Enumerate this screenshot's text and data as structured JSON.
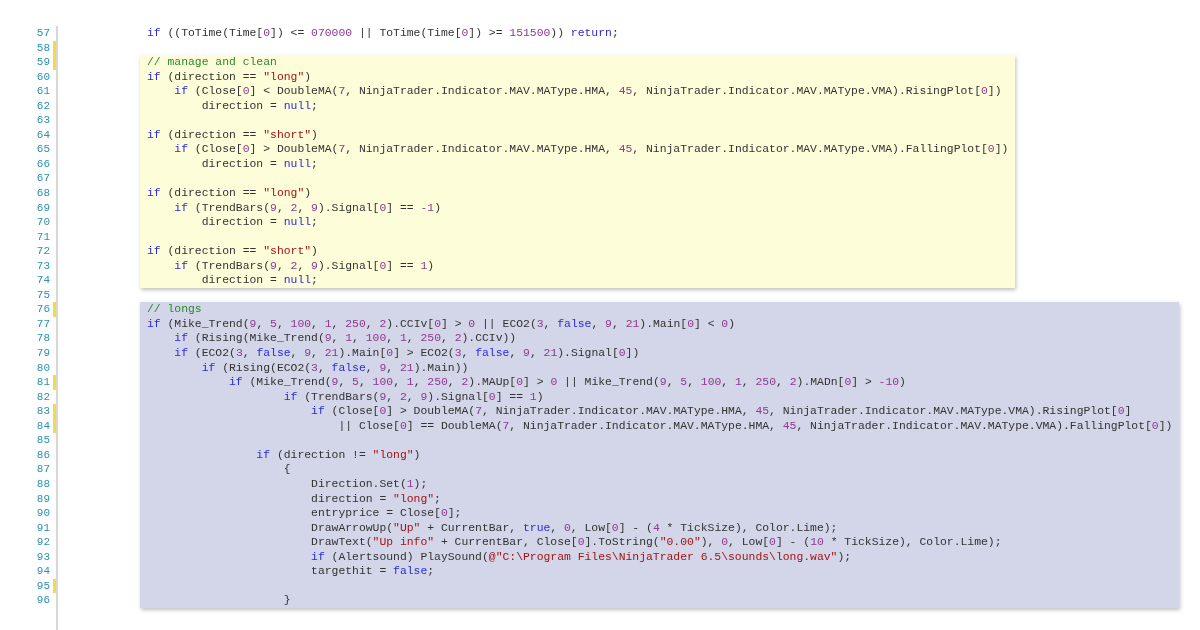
{
  "blocks": [
    {
      "kind": "plain",
      "lines": [
        {
          "number": "57",
          "changed": false,
          "tokens": [
            {
              "kind": "keyword",
              "text": "if"
            },
            {
              "kind": "plain",
              "text": " ((ToTime(Time["
            },
            {
              "kind": "number",
              "text": "0"
            },
            {
              "kind": "plain",
              "text": "]) <= "
            },
            {
              "kind": "number",
              "text": "070000"
            },
            {
              "kind": "plain",
              "text": " || ToTime(Time["
            },
            {
              "kind": "number",
              "text": "0"
            },
            {
              "kind": "plain",
              "text": "]) >= "
            },
            {
              "kind": "number",
              "text": "151500"
            },
            {
              "kind": "plain",
              "text": ")) "
            },
            {
              "kind": "keyword",
              "text": "return"
            },
            {
              "kind": "plain",
              "text": ";"
            }
          ]
        },
        {
          "number": "58",
          "changed": true
        }
      ]
    },
    {
      "kind": "highlight",
      "color": "#fefdd9",
      "lines": [
        {
          "number": "59",
          "changed": true,
          "tokens": [
            {
              "kind": "comment",
              "text": "// manage and clean"
            }
          ]
        },
        {
          "number": "60",
          "changed": false,
          "tokens": [
            {
              "kind": "keyword",
              "text": "if"
            },
            {
              "kind": "plain",
              "text": " (direction == "
            },
            {
              "kind": "string",
              "text": "\"long\""
            },
            {
              "kind": "plain",
              "text": ")"
            }
          ]
        },
        {
          "number": "61",
          "changed": false,
          "tokens": [
            {
              "kind": "keyword",
              "text": "    if"
            },
            {
              "kind": "plain",
              "text": " (Close["
            },
            {
              "kind": "number",
              "text": "0"
            },
            {
              "kind": "plain",
              "text": "] < DoubleMA("
            },
            {
              "kind": "number",
              "text": "7"
            },
            {
              "kind": "plain",
              "text": ", NinjaTrader.Indicator.MAV.MAType.HMA, "
            },
            {
              "kind": "number",
              "text": "45"
            },
            {
              "kind": "plain",
              "text": ", NinjaTrader.Indicator.MAV.MAType.VMA).RisingPlot["
            },
            {
              "kind": "number",
              "text": "0"
            },
            {
              "kind": "plain",
              "text": "])"
            }
          ]
        },
        {
          "number": "62",
          "changed": false,
          "tokens": [
            {
              "kind": "plain",
              "text": "        direction = "
            },
            {
              "kind": "keyword",
              "text": "null"
            },
            {
              "kind": "plain",
              "text": ";"
            }
          ]
        },
        {
          "number": "63",
          "changed": false
        },
        {
          "number": "64",
          "changed": false,
          "tokens": [
            {
              "kind": "keyword",
              "text": "if"
            },
            {
              "kind": "plain",
              "text": " (direction == "
            },
            {
              "kind": "string",
              "text": "\"short\""
            },
            {
              "kind": "plain",
              "text": ")"
            }
          ]
        },
        {
          "number": "65",
          "changed": false,
          "tokens": [
            {
              "kind": "keyword",
              "text": "    if"
            },
            {
              "kind": "plain",
              "text": " (Close["
            },
            {
              "kind": "number",
              "text": "0"
            },
            {
              "kind": "plain",
              "text": "] > DoubleMA("
            },
            {
              "kind": "number",
              "text": "7"
            },
            {
              "kind": "plain",
              "text": ", NinjaTrader.Indicator.MAV.MAType.HMA, "
            },
            {
              "kind": "number",
              "text": "45"
            },
            {
              "kind": "plain",
              "text": ", NinjaTrader.Indicator.MAV.MAType.VMA).FallingPlot["
            },
            {
              "kind": "number",
              "text": "0"
            },
            {
              "kind": "plain",
              "text": "])"
            }
          ]
        },
        {
          "number": "66",
          "changed": false,
          "tokens": [
            {
              "kind": "plain",
              "text": "        direction = "
            },
            {
              "kind": "keyword",
              "text": "null"
            },
            {
              "kind": "plain",
              "text": ";"
            }
          ]
        },
        {
          "number": "67",
          "changed": false
        },
        {
          "number": "68",
          "changed": false,
          "tokens": [
            {
              "kind": "keyword",
              "text": "if"
            },
            {
              "kind": "plain",
              "text": " (direction == "
            },
            {
              "kind": "string",
              "text": "\"long\""
            },
            {
              "kind": "plain",
              "text": ")"
            }
          ]
        },
        {
          "number": "69",
          "changed": false,
          "tokens": [
            {
              "kind": "keyword",
              "text": "    if"
            },
            {
              "kind": "plain",
              "text": " (TrendBars("
            },
            {
              "kind": "number",
              "text": "9"
            },
            {
              "kind": "plain",
              "text": ", "
            },
            {
              "kind": "number",
              "text": "2"
            },
            {
              "kind": "plain",
              "text": ", "
            },
            {
              "kind": "number",
              "text": "9"
            },
            {
              "kind": "plain",
              "text": ").Signal["
            },
            {
              "kind": "number",
              "text": "0"
            },
            {
              "kind": "plain",
              "text": "] == "
            },
            {
              "kind": "number",
              "text": "-1"
            },
            {
              "kind": "plain",
              "text": ")"
            }
          ]
        },
        {
          "number": "70",
          "changed": false,
          "tokens": [
            {
              "kind": "plain",
              "text": "        direction = "
            },
            {
              "kind": "keyword",
              "text": "null"
            },
            {
              "kind": "plain",
              "text": ";"
            }
          ]
        },
        {
          "number": "71",
          "changed": false
        },
        {
          "number": "72",
          "changed": false,
          "tokens": [
            {
              "kind": "keyword",
              "text": "if"
            },
            {
              "kind": "plain",
              "text": " (direction == "
            },
            {
              "kind": "string",
              "text": "\"short\""
            },
            {
              "kind": "plain",
              "text": ")"
            }
          ]
        },
        {
          "number": "73",
          "changed": false,
          "tokens": [
            {
              "kind": "keyword",
              "text": "    if"
            },
            {
              "kind": "plain",
              "text": " (TrendBars("
            },
            {
              "kind": "number",
              "text": "9"
            },
            {
              "kind": "plain",
              "text": ", "
            },
            {
              "kind": "number",
              "text": "2"
            },
            {
              "kind": "plain",
              "text": ", "
            },
            {
              "kind": "number",
              "text": "9"
            },
            {
              "kind": "plain",
              "text": ").Signal["
            },
            {
              "kind": "number",
              "text": "0"
            },
            {
              "kind": "plain",
              "text": "] == "
            },
            {
              "kind": "number",
              "text": "1"
            },
            {
              "kind": "plain",
              "text": ")"
            }
          ]
        },
        {
          "number": "74",
          "changed": false,
          "tokens": [
            {
              "kind": "plain",
              "text": "        direction = "
            },
            {
              "kind": "keyword",
              "text": "null"
            },
            {
              "kind": "plain",
              "text": ";"
            }
          ]
        }
      ]
    },
    {
      "kind": "plain",
      "lines": [
        {
          "number": "75",
          "changed": false
        }
      ]
    },
    {
      "kind": "highlight",
      "color": "#d3d5e8",
      "lines": [
        {
          "number": "76",
          "changed": true,
          "tokens": [
            {
              "kind": "comment",
              "text": "// longs"
            }
          ]
        },
        {
          "number": "77",
          "changed": false,
          "tokens": [
            {
              "kind": "keyword",
              "text": "if"
            },
            {
              "kind": "plain",
              "text": " (Mike_Trend("
            },
            {
              "kind": "number",
              "text": "9"
            },
            {
              "kind": "plain",
              "text": ", "
            },
            {
              "kind": "number",
              "text": "5"
            },
            {
              "kind": "plain",
              "text": ", "
            },
            {
              "kind": "number",
              "text": "100"
            },
            {
              "kind": "plain",
              "text": ", "
            },
            {
              "kind": "number",
              "text": "1"
            },
            {
              "kind": "plain",
              "text": ", "
            },
            {
              "kind": "number",
              "text": "250"
            },
            {
              "kind": "plain",
              "text": ", "
            },
            {
              "kind": "number",
              "text": "2"
            },
            {
              "kind": "plain",
              "text": ").CCIv["
            },
            {
              "kind": "number",
              "text": "0"
            },
            {
              "kind": "plain",
              "text": "] > "
            },
            {
              "kind": "number",
              "text": "0"
            },
            {
              "kind": "plain",
              "text": " || ECO2("
            },
            {
              "kind": "number",
              "text": "3"
            },
            {
              "kind": "plain",
              "text": ", "
            },
            {
              "kind": "keyword",
              "text": "false"
            },
            {
              "kind": "plain",
              "text": ", "
            },
            {
              "kind": "number",
              "text": "9"
            },
            {
              "kind": "plain",
              "text": ", "
            },
            {
              "kind": "number",
              "text": "21"
            },
            {
              "kind": "plain",
              "text": ").Main["
            },
            {
              "kind": "number",
              "text": "0"
            },
            {
              "kind": "plain",
              "text": "] < "
            },
            {
              "kind": "number",
              "text": "0"
            },
            {
              "kind": "plain",
              "text": ")"
            }
          ]
        },
        {
          "number": "78",
          "changed": false,
          "tokens": [
            {
              "kind": "keyword",
              "text": "    if"
            },
            {
              "kind": "plain",
              "text": " (Rising(Mike_Trend("
            },
            {
              "kind": "number",
              "text": "9"
            },
            {
              "kind": "plain",
              "text": ", "
            },
            {
              "kind": "number",
              "text": "1"
            },
            {
              "kind": "plain",
              "text": ", "
            },
            {
              "kind": "number",
              "text": "100"
            },
            {
              "kind": "plain",
              "text": ", "
            },
            {
              "kind": "number",
              "text": "1"
            },
            {
              "kind": "plain",
              "text": ", "
            },
            {
              "kind": "number",
              "text": "250"
            },
            {
              "kind": "plain",
              "text": ", "
            },
            {
              "kind": "number",
              "text": "2"
            },
            {
              "kind": "plain",
              "text": ").CCIv))"
            }
          ]
        },
        {
          "number": "79",
          "changed": false,
          "tokens": [
            {
              "kind": "keyword",
              "text": "    if"
            },
            {
              "kind": "plain",
              "text": " (ECO2("
            },
            {
              "kind": "number",
              "text": "3"
            },
            {
              "kind": "plain",
              "text": ", "
            },
            {
              "kind": "keyword",
              "text": "false"
            },
            {
              "kind": "plain",
              "text": ", "
            },
            {
              "kind": "number",
              "text": "9"
            },
            {
              "kind": "plain",
              "text": ", "
            },
            {
              "kind": "number",
              "text": "21"
            },
            {
              "kind": "plain",
              "text": ").Main["
            },
            {
              "kind": "number",
              "text": "0"
            },
            {
              "kind": "plain",
              "text": "] > ECO2("
            },
            {
              "kind": "number",
              "text": "3"
            },
            {
              "kind": "plain",
              "text": ", "
            },
            {
              "kind": "keyword",
              "text": "false"
            },
            {
              "kind": "plain",
              "text": ", "
            },
            {
              "kind": "number",
              "text": "9"
            },
            {
              "kind": "plain",
              "text": ", "
            },
            {
              "kind": "number",
              "text": "21"
            },
            {
              "kind": "plain",
              "text": ").Signal["
            },
            {
              "kind": "number",
              "text": "0"
            },
            {
              "kind": "plain",
              "text": "])"
            }
          ]
        },
        {
          "number": "80",
          "changed": false,
          "tokens": [
            {
              "kind": "keyword",
              "text": "        if"
            },
            {
              "kind": "plain",
              "text": " (Rising(ECO2("
            },
            {
              "kind": "number",
              "text": "3"
            },
            {
              "kind": "plain",
              "text": ", "
            },
            {
              "kind": "keyword",
              "text": "false"
            },
            {
              "kind": "plain",
              "text": ", "
            },
            {
              "kind": "number",
              "text": "9"
            },
            {
              "kind": "plain",
              "text": ", "
            },
            {
              "kind": "number",
              "text": "21"
            },
            {
              "kind": "plain",
              "text": ").Main))"
            }
          ]
        },
        {
          "number": "81",
          "changed": true,
          "tokens": [
            {
              "kind": "keyword",
              "text": "            if"
            },
            {
              "kind": "plain",
              "text": " (Mike_Trend("
            },
            {
              "kind": "number",
              "text": "9"
            },
            {
              "kind": "plain",
              "text": ", "
            },
            {
              "kind": "number",
              "text": "5"
            },
            {
              "kind": "plain",
              "text": ", "
            },
            {
              "kind": "number",
              "text": "100"
            },
            {
              "kind": "plain",
              "text": ", "
            },
            {
              "kind": "number",
              "text": "1"
            },
            {
              "kind": "plain",
              "text": ", "
            },
            {
              "kind": "number",
              "text": "250"
            },
            {
              "kind": "plain",
              "text": ", "
            },
            {
              "kind": "number",
              "text": "2"
            },
            {
              "kind": "plain",
              "text": ").MAUp["
            },
            {
              "kind": "number",
              "text": "0"
            },
            {
              "kind": "plain",
              "text": "] > "
            },
            {
              "kind": "number",
              "text": "0"
            },
            {
              "kind": "plain",
              "text": " || Mike_Trend("
            },
            {
              "kind": "number",
              "text": "9"
            },
            {
              "kind": "plain",
              "text": ", "
            },
            {
              "kind": "number",
              "text": "5"
            },
            {
              "kind": "plain",
              "text": ", "
            },
            {
              "kind": "number",
              "text": "100"
            },
            {
              "kind": "plain",
              "text": ", "
            },
            {
              "kind": "number",
              "text": "1"
            },
            {
              "kind": "plain",
              "text": ", "
            },
            {
              "kind": "number",
              "text": "250"
            },
            {
              "kind": "plain",
              "text": ", "
            },
            {
              "kind": "number",
              "text": "2"
            },
            {
              "kind": "plain",
              "text": ").MADn["
            },
            {
              "kind": "number",
              "text": "0"
            },
            {
              "kind": "plain",
              "text": "] > "
            },
            {
              "kind": "number",
              "text": "-10"
            },
            {
              "kind": "plain",
              "text": ")"
            }
          ]
        },
        {
          "number": "82",
          "changed": false,
          "tokens": [
            {
              "kind": "keyword",
              "text": "                    if"
            },
            {
              "kind": "plain",
              "text": " (TrendBars("
            },
            {
              "kind": "number",
              "text": "9"
            },
            {
              "kind": "plain",
              "text": ", "
            },
            {
              "kind": "number",
              "text": "2"
            },
            {
              "kind": "plain",
              "text": ", "
            },
            {
              "kind": "number",
              "text": "9"
            },
            {
              "kind": "plain",
              "text": ").Signal["
            },
            {
              "kind": "number",
              "text": "0"
            },
            {
              "kind": "plain",
              "text": "] == "
            },
            {
              "kind": "number",
              "text": "1"
            },
            {
              "kind": "plain",
              "text": ")"
            }
          ]
        },
        {
          "number": "83",
          "changed": true,
          "tokens": [
            {
              "kind": "keyword",
              "text": "                        if"
            },
            {
              "kind": "plain",
              "text": " (Close["
            },
            {
              "kind": "number",
              "text": "0"
            },
            {
              "kind": "plain",
              "text": "] > DoubleMA("
            },
            {
              "kind": "number",
              "text": "7"
            },
            {
              "kind": "plain",
              "text": ", NinjaTrader.Indicator.MAV.MAType.HMA, "
            },
            {
              "kind": "number",
              "text": "45"
            },
            {
              "kind": "plain",
              "text": ", NinjaTrader.Indicator.MAV.MAType.VMA).RisingPlot["
            },
            {
              "kind": "number",
              "text": "0"
            },
            {
              "kind": "plain",
              "text": "]"
            }
          ]
        },
        {
          "number": "84",
          "changed": true,
          "tokens": [
            {
              "kind": "plain",
              "text": "                            || Close["
            },
            {
              "kind": "number",
              "text": "0"
            },
            {
              "kind": "plain",
              "text": "] == DoubleMA("
            },
            {
              "kind": "number",
              "text": "7"
            },
            {
              "kind": "plain",
              "text": ", NinjaTrader.Indicator.MAV.MAType.HMA, "
            },
            {
              "kind": "number",
              "text": "45"
            },
            {
              "kind": "plain",
              "text": ", NinjaTrader.Indicator.MAV.MAType.VMA).FallingPlot["
            },
            {
              "kind": "number",
              "text": "0"
            },
            {
              "kind": "plain",
              "text": "])"
            }
          ]
        },
        {
          "number": "85",
          "changed": false
        },
        {
          "number": "86",
          "changed": false,
          "tokens": [
            {
              "kind": "keyword",
              "text": "                if"
            },
            {
              "kind": "plain",
              "text": " (direction != "
            },
            {
              "kind": "string",
              "text": "\"long\""
            },
            {
              "kind": "plain",
              "text": ")"
            }
          ]
        },
        {
          "number": "87",
          "changed": false,
          "tokens": [
            {
              "kind": "plain",
              "text": "                    {"
            }
          ]
        },
        {
          "number": "88",
          "changed": false,
          "tokens": [
            {
              "kind": "plain",
              "text": "                        Direction.Set("
            },
            {
              "kind": "number",
              "text": "1"
            },
            {
              "kind": "plain",
              "text": ");"
            }
          ]
        },
        {
          "number": "89",
          "changed": false,
          "tokens": [
            {
              "kind": "plain",
              "text": "                        direction = "
            },
            {
              "kind": "string",
              "text": "\"long\""
            },
            {
              "kind": "plain",
              "text": ";"
            }
          ]
        },
        {
          "number": "90",
          "changed": false,
          "tokens": [
            {
              "kind": "plain",
              "text": "                        entryprice = Close["
            },
            {
              "kind": "number",
              "text": "0"
            },
            {
              "kind": "plain",
              "text": "];"
            }
          ]
        },
        {
          "number": "91",
          "changed": false,
          "tokens": [
            {
              "kind": "plain",
              "text": "                        DrawArrowUp("
            },
            {
              "kind": "string",
              "text": "\"Up\""
            },
            {
              "kind": "plain",
              "text": " + CurrentBar, "
            },
            {
              "kind": "keyword",
              "text": "true"
            },
            {
              "kind": "plain",
              "text": ", "
            },
            {
              "kind": "number",
              "text": "0"
            },
            {
              "kind": "plain",
              "text": ", Low["
            },
            {
              "kind": "number",
              "text": "0"
            },
            {
              "kind": "plain",
              "text": "] - ("
            },
            {
              "kind": "number",
              "text": "4"
            },
            {
              "kind": "plain",
              "text": " * TickSize), Color.Lime);"
            }
          ]
        },
        {
          "number": "92",
          "changed": false,
          "tokens": [
            {
              "kind": "plain",
              "text": "                        DrawText("
            },
            {
              "kind": "string",
              "text": "\"Up info\""
            },
            {
              "kind": "plain",
              "text": " + CurrentBar, Close["
            },
            {
              "kind": "number",
              "text": "0"
            },
            {
              "kind": "plain",
              "text": "].ToString("
            },
            {
              "kind": "string",
              "text": "\"0.00\""
            },
            {
              "kind": "plain",
              "text": "), "
            },
            {
              "kind": "number",
              "text": "0"
            },
            {
              "kind": "plain",
              "text": ", Low["
            },
            {
              "kind": "number",
              "text": "0"
            },
            {
              "kind": "plain",
              "text": "] - ("
            },
            {
              "kind": "number",
              "text": "10"
            },
            {
              "kind": "plain",
              "text": " * TickSize), Color.Lime);"
            }
          ]
        },
        {
          "number": "93",
          "changed": false,
          "tokens": [
            {
              "kind": "keyword",
              "text": "                        if"
            },
            {
              "kind": "plain",
              "text": " (Alertsound) PlaySound("
            },
            {
              "kind": "string",
              "text": "@\"C:\\Program Files\\NinjaTrader 6.5\\sounds\\long.wav\""
            },
            {
              "kind": "plain",
              "text": ");"
            }
          ]
        },
        {
          "number": "94",
          "changed": false,
          "tokens": [
            {
              "kind": "plain",
              "text": "                        targethit = "
            },
            {
              "kind": "keyword",
              "text": "false"
            },
            {
              "kind": "plain",
              "text": ";"
            }
          ]
        },
        {
          "number": "95",
          "changed": true
        },
        {
          "number": "96",
          "changed": false,
          "tokens": [
            {
              "kind": "plain",
              "text": "                    }"
            }
          ]
        }
      ]
    }
  ]
}
